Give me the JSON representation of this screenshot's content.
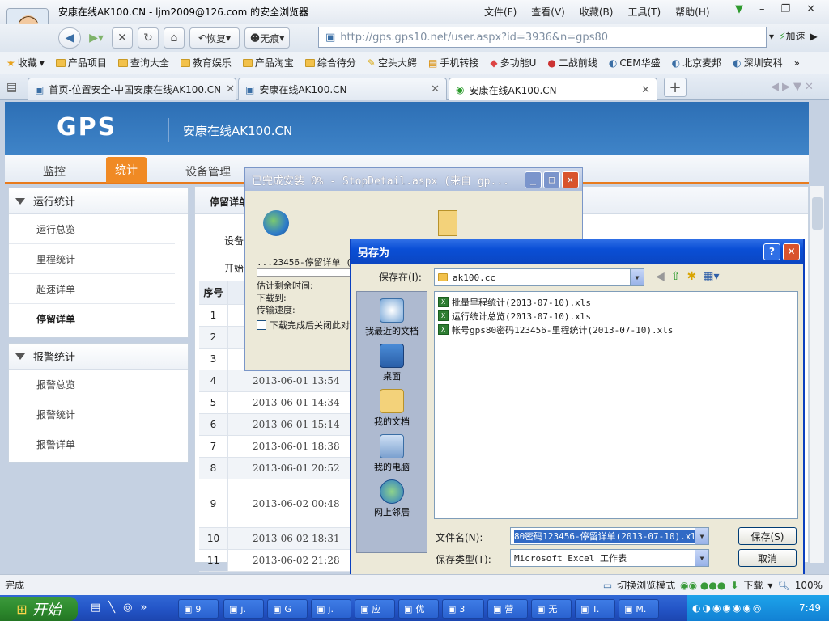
{
  "browser": {
    "window_title": "安康在线AK100.CN - ljm2009@126.com 的安全浏览器",
    "menus": [
      "文件(F)",
      "查看(V)",
      "收藏(B)",
      "工具(T)",
      "帮助(H)"
    ],
    "nav": {
      "restore_label": "恢复",
      "notrace_label": "无痕",
      "url": "http://gps.gps10.net/user.aspx?id=3936&n=gps80",
      "accelerate_label": "加速"
    },
    "bookmarks": [
      "收藏",
      "产品项目",
      "查询大全",
      "教育娱乐",
      "产品淘宝",
      "综合待分",
      "空头大鳄",
      "手机转接",
      "多功能U",
      "二战前线",
      "CEM华盛",
      "北京麦邦",
      "深圳安科"
    ],
    "tabs": [
      "首页-位置安全-中国安康在线AK100.CN",
      "安康在线AK100.CN",
      "安康在线AK100.CN"
    ]
  },
  "site": {
    "logo": "GPS",
    "name": "安康在线AK100.CN",
    "topnav": [
      "监控",
      "统计",
      "设备管理"
    ],
    "panel1": {
      "title": "运行统计",
      "items": [
        "运行总览",
        "里程统计",
        "超速详单",
        "停留详单"
      ]
    },
    "panel2": {
      "title": "报警统计",
      "items": [
        "报警总览",
        "报警统计",
        "报警详单"
      ]
    },
    "main": {
      "title": "停留详单",
      "device_label": "设备:",
      "start_label": "开始"
    },
    "table": {
      "header": "序号",
      "rows": [
        {
          "n": "1",
          "d": ""
        },
        {
          "n": "2",
          "d": ""
        },
        {
          "n": "3",
          "d": ""
        },
        {
          "n": "4",
          "d": "2013-06-01 13:54"
        },
        {
          "n": "5",
          "d": "2013-06-01 14:34"
        },
        {
          "n": "6",
          "d": "2013-06-01 15:14"
        },
        {
          "n": "7",
          "d": "2013-06-01 18:38"
        },
        {
          "n": "8",
          "d": "2013-06-01 20:52"
        },
        {
          "n": "9",
          "d": "2013-06-02 00:48"
        },
        {
          "n": "10",
          "d": "2013-06-02 18:31"
        },
        {
          "n": "11",
          "d": "2013-06-02 21:28"
        }
      ]
    }
  },
  "download": {
    "title": "已完成安装 0% - StopDetail.aspx (来自 gp...",
    "filename": "...23456-停留详单 (20",
    "remaining_label": "估计剩余时间:",
    "downloaded_label": "下载到:",
    "speed_label": "传输速度:",
    "close_label": "下载完成后关闭此对",
    "progress": 0
  },
  "saveas": {
    "title": "另存为",
    "savein_label": "保存在(I):",
    "folder": "ak100.cc",
    "places": [
      "我最近的文档",
      "桌面",
      "我的文档",
      "我的电脑",
      "网上邻居"
    ],
    "files": [
      "批量里程统计(2013-07-10).xls",
      "运行统计总览(2013-07-10).xls",
      "帐号gps80密码123456-里程统计(2013-07-10).xls"
    ],
    "filename_label": "文件名(N):",
    "filename": "80密码123456-停留详单(2013-07-10).xls",
    "filetype_label": "保存类型(T):",
    "filetype": "Microsoft Excel 工作表",
    "save_label": "保存(S)",
    "cancel_label": "取消"
  },
  "status": {
    "text": "完成",
    "mode": "切换浏览模式",
    "download": "下载",
    "zoom": "100%"
  },
  "taskbar": {
    "start": "开始",
    "items": [
      "9",
      "j.",
      "G",
      "j.",
      "应",
      "优",
      "3",
      "营",
      "无",
      "T.",
      "M."
    ],
    "clock": "7:49"
  }
}
